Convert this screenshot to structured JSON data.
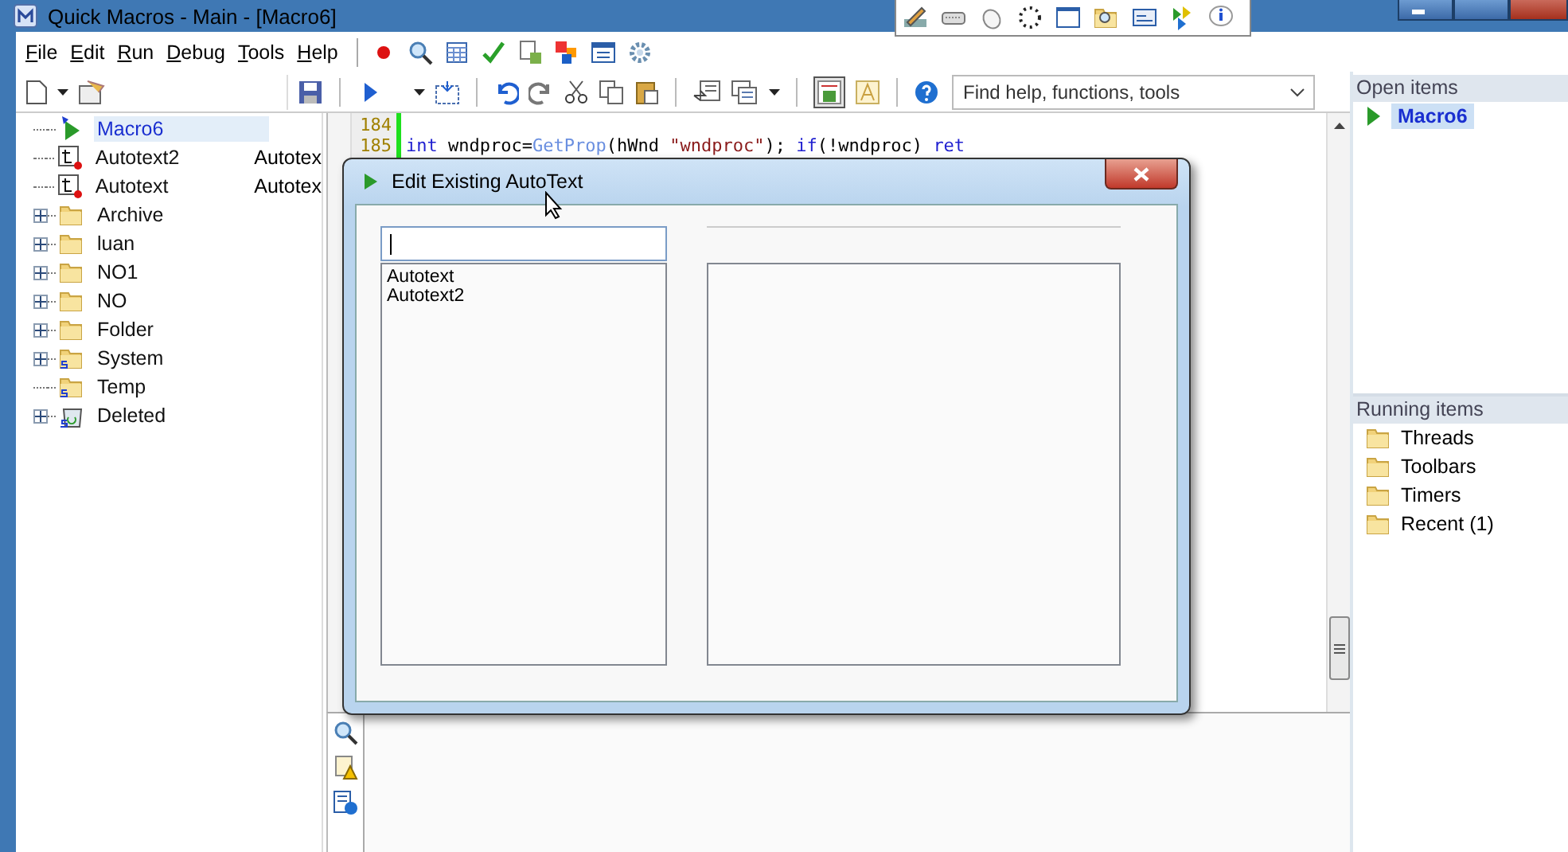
{
  "window": {
    "title": "Quick Macros - Main - [Macro6]"
  },
  "menu": [
    {
      "label": "File"
    },
    {
      "label": "Edit"
    },
    {
      "label": "Run"
    },
    {
      "label": "Debug"
    },
    {
      "label": "Tools"
    },
    {
      "label": "Help"
    }
  ],
  "search": {
    "placeholder": "Find help, functions, tools"
  },
  "tree": [
    {
      "kind": "macro",
      "label": "Macro6",
      "selected": true,
      "has_children": false
    },
    {
      "kind": "autotext",
      "label": "Autotext2",
      "column_2": "Autotex",
      "selected": false,
      "has_children": false
    },
    {
      "kind": "autotext",
      "label": "Autotext",
      "column_2": "Autotex",
      "selected": false,
      "has_children": false
    },
    {
      "kind": "folder",
      "label": "Archive",
      "selected": false,
      "has_children": true
    },
    {
      "kind": "folder",
      "label": "luan",
      "selected": false,
      "has_children": true
    },
    {
      "kind": "folder",
      "label": "NO1",
      "selected": false,
      "has_children": true
    },
    {
      "kind": "folder",
      "label": "NO",
      "selected": false,
      "has_children": true
    },
    {
      "kind": "folder",
      "label": "Folder",
      "selected": false,
      "has_children": true
    },
    {
      "kind": "system",
      "label": "System",
      "selected": false,
      "has_children": true
    },
    {
      "kind": "system",
      "label": "Temp",
      "selected": false,
      "has_children": false
    },
    {
      "kind": "trash",
      "label": "Deleted",
      "selected": false,
      "has_children": true
    }
  ],
  "editor": {
    "lines": [
      {
        "number": "184"
      },
      {
        "number": "185",
        "tokens": [
          {
            "kind": "keyword",
            "text": "int"
          },
          {
            "kind": "plain",
            "text": " wndproc="
          },
          {
            "kind": "function",
            "text": "GetProp"
          },
          {
            "kind": "plain",
            "text": "(hWnd "
          },
          {
            "kind": "string",
            "text": "\"wndproc\""
          },
          {
            "kind": "plain",
            "text": "); "
          },
          {
            "kind": "keyword",
            "text": "if"
          },
          {
            "kind": "plain",
            "text": "(!wndproc) "
          },
          {
            "kind": "keyword",
            "text": "ret"
          }
        ]
      }
    ]
  },
  "open_items": {
    "title": "Open items",
    "items": [
      {
        "label": "Macro6",
        "selected": true
      }
    ]
  },
  "running_items": {
    "title": "Running items",
    "items": [
      {
        "label": "Threads"
      },
      {
        "label": "Toolbars"
      },
      {
        "label": "Timers"
      },
      {
        "label": "Recent (1)"
      }
    ]
  },
  "dialog": {
    "title": "Edit Existing AutoText",
    "list": [
      "Autotext",
      "Autotext2"
    ]
  }
}
